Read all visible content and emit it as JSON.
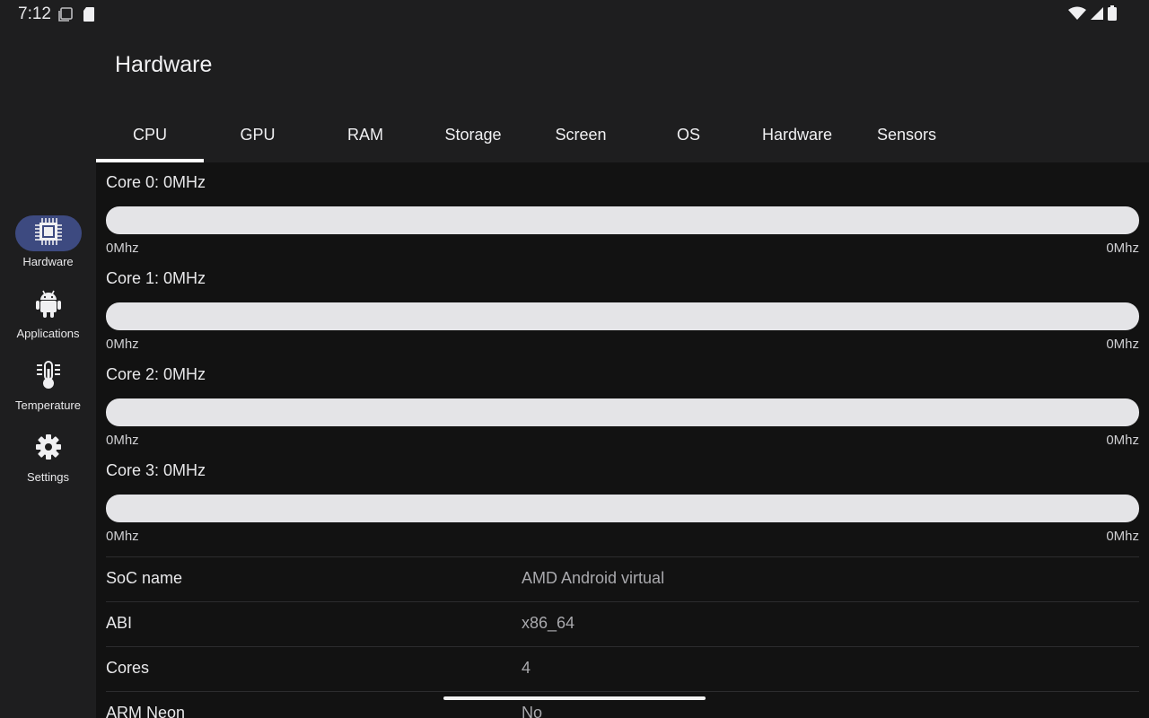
{
  "status_bar": {
    "time": "7:12",
    "left_icons": [
      "screenshot-icon",
      "sd-card-icon"
    ],
    "right_icons": [
      "wifi-icon",
      "signal-icon",
      "battery-icon"
    ]
  },
  "nav": {
    "items": [
      {
        "label": "Hardware",
        "icon": "cpu-chip-icon",
        "active": true
      },
      {
        "label": "Applications",
        "icon": "android-icon",
        "active": false
      },
      {
        "label": "Temperature",
        "icon": "thermometer-icon",
        "active": false
      },
      {
        "label": "Settings",
        "icon": "gear-icon",
        "active": false
      }
    ]
  },
  "header": {
    "title": "Hardware"
  },
  "tabs": [
    {
      "label": "CPU",
      "active": true
    },
    {
      "label": "GPU",
      "active": false
    },
    {
      "label": "RAM",
      "active": false
    },
    {
      "label": "Storage",
      "active": false
    },
    {
      "label": "Screen",
      "active": false
    },
    {
      "label": "OS",
      "active": false
    },
    {
      "label": "Hardware",
      "active": false
    },
    {
      "label": "Sensors",
      "active": false
    }
  ],
  "cores": [
    {
      "title": "Core 0: 0MHz",
      "min": "0Mhz",
      "max": "0Mhz",
      "progress": 0
    },
    {
      "title": "Core 1: 0MHz",
      "min": "0Mhz",
      "max": "0Mhz",
      "progress": 0
    },
    {
      "title": "Core 2: 0MHz",
      "min": "0Mhz",
      "max": "0Mhz",
      "progress": 0
    },
    {
      "title": "Core 3: 0MHz",
      "min": "0Mhz",
      "max": "0Mhz",
      "progress": 0
    }
  ],
  "info": [
    {
      "key": "SoC name",
      "value": "AMD Android virtual"
    },
    {
      "key": "ABI",
      "value": "x86_64"
    },
    {
      "key": "Cores",
      "value": "4"
    },
    {
      "key": "ARM Neon",
      "value": "No"
    }
  ],
  "colors": {
    "accent": "#3d4a80",
    "bar_track": "#e4e4e7",
    "content_bg": "#121212"
  }
}
